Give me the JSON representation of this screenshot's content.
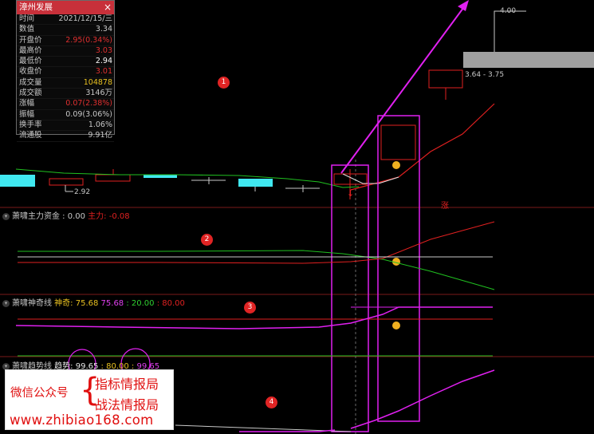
{
  "info_panel": {
    "title": "漳州发展",
    "close_icon": "×",
    "rows": [
      {
        "k": "时间",
        "v": "2021/12/15/三",
        "c": "#c8c8c8"
      },
      {
        "k": "数值",
        "v": "3.34",
        "c": "#c8c8c8"
      },
      {
        "k": "开盘价",
        "v": "2.95(0.34%)",
        "c": "#e03030"
      },
      {
        "k": "最高价",
        "v": "3.03",
        "c": "#e03030"
      },
      {
        "k": "最低价",
        "v": "2.94",
        "c": "#ffffff"
      },
      {
        "k": "收盘价",
        "v": "3.01",
        "c": "#e03030"
      },
      {
        "k": "成交量",
        "v": "104878",
        "c": "#e8c020"
      },
      {
        "k": "成交额",
        "v": "3146万",
        "c": "#c8c8c8"
      },
      {
        "k": "涨幅",
        "v": "0.07(2.38%)",
        "c": "#e03030"
      },
      {
        "k": "振幅",
        "v": "0.09(3.06%)",
        "c": "#c8c8c8"
      },
      {
        "k": "换手率",
        "v": "1.06%",
        "c": "#c8c8c8"
      },
      {
        "k": "流通股",
        "v": "9.91亿",
        "c": "#c8c8c8"
      }
    ]
  },
  "price_labels": {
    "high": "4.00",
    "range": "3.64 - 3.75",
    "low": "2.92",
    "zhang": "涨"
  },
  "panels": [
    {
      "name": "萧啸主力资金",
      "parts": [
        {
          "t": "萧啸主力资金",
          "c": "#c8c8c8"
        },
        {
          "t": " : 0.00",
          "c": "#c8c8c8"
        },
        {
          "t": "  主力: -0.08",
          "c": "#e02020"
        }
      ]
    },
    {
      "name": "萧啸神奇线",
      "parts": [
        {
          "t": "萧啸神奇线",
          "c": "#c8c8c8"
        },
        {
          "t": "  神奇: 75.68",
          "c": "#e8c020"
        },
        {
          "t": "  75.68",
          "c": "#e040f0"
        },
        {
          "t": "  : 20.00",
          "c": "#30d030"
        },
        {
          "t": "  : 80.00",
          "c": "#e02020"
        }
      ]
    },
    {
      "name": "萧啸趋势线",
      "parts": [
        {
          "t": "萧啸趋势线",
          "c": "#c8c8c8"
        },
        {
          "t": "  趋势: ",
          "c": "#e8e8e8"
        },
        {
          "t": "99.65",
          "c": "#e8e8e8"
        },
        {
          "t": " : 80.00 : ",
          "c": "#e8c020"
        },
        {
          "t": "99.65",
          "c": "#e040f0"
        }
      ]
    }
  ],
  "badges": [
    "1",
    "2",
    "3",
    "4"
  ],
  "watermark": {
    "wechat": "微信公众号",
    "brace": "{",
    "line1": "指标情报局",
    "line2": "战法情报局",
    "url": "www.zhibiao168.com"
  },
  "colors": {
    "red": "#e02020",
    "green": "#20c020",
    "magenta": "#e020f0",
    "cyan": "#40e8f0",
    "grid": "#7a1a1a"
  }
}
